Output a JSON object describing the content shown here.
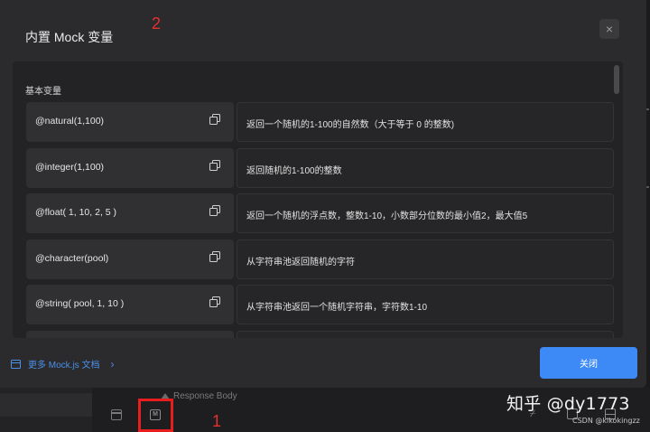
{
  "modal": {
    "title": "内置 Mock 变量",
    "close_icon": "×",
    "section_title": "基本变量",
    "rows": [
      {
        "code": "@natural(1,100)",
        "desc": "返回一个随机的1-100的自然数（大于等于 0 的整数)"
      },
      {
        "code": "@integer(1,100)",
        "desc": "返回随机的1-100的整数"
      },
      {
        "code": "@float( 1, 10, 2, 5 )",
        "desc": "返回一个随机的浮点数，整数1-10，小数部分位数的最小值2，最大值5"
      },
      {
        "code": "@character(pool)",
        "desc": "从字符串池返回随机的字符"
      },
      {
        "code": "@string( pool, 1, 10 )",
        "desc": "从字符串池返回一个随机字符串，字符数1-10"
      }
    ],
    "footer_link": "更多 Mock.js 文档",
    "footer_chevron": "›",
    "close_button": "关闭"
  },
  "background": {
    "response_label": "Response Body",
    "mock_icon_glyph": "M",
    "collapse_glyph": "⌿"
  },
  "annotations": {
    "num_one": "1",
    "num_two": "2",
    "red_box_color": "#e81e1e"
  },
  "watermark": {
    "main": "知乎 @dy1773",
    "sub": "CSDN @kikokingzz"
  },
  "colors": {
    "accent": "#3d8af7",
    "link": "#4a8fe8",
    "modal_bg": "#2b2b2d"
  }
}
